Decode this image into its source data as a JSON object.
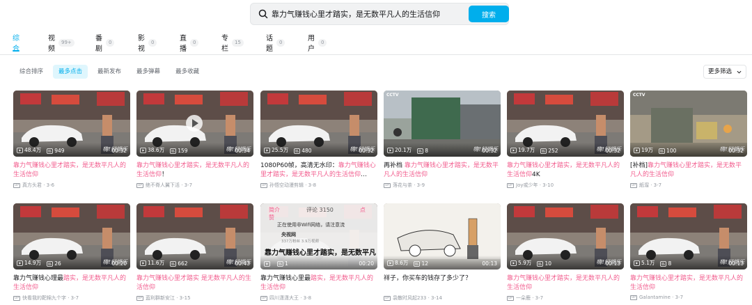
{
  "search": {
    "query": "靠力气赚钱心里才踏实，是无数平凡人的生活信仰",
    "button_label": "搜索"
  },
  "tabs": [
    {
      "label": "综合",
      "count": ""
    },
    {
      "label": "视频",
      "count": "99+"
    },
    {
      "label": "番剧",
      "count": "0"
    },
    {
      "label": "影视",
      "count": "0"
    },
    {
      "label": "直播",
      "count": "0"
    },
    {
      "label": "专栏",
      "count": "15"
    },
    {
      "label": "话题",
      "count": "0"
    },
    {
      "label": "用户",
      "count": "0"
    }
  ],
  "sort_options": [
    "综合排序",
    "最多点击",
    "最新发布",
    "最多弹幕",
    "最多收藏"
  ],
  "filter_label": "更多筛选",
  "videos": [
    {
      "views": "48.4万",
      "danmaku": "949",
      "duration": "00:32",
      "title_pre": "",
      "title_hl": "靠力气赚钱心里才踏实，是无数平凡人的生活信仰",
      "title_post": "",
      "author": "真方头君",
      "date": "3-6"
    },
    {
      "views": "38.6万",
      "danmaku": "159",
      "duration": "00:34",
      "title_pre": "",
      "title_hl": "靠力气赚钱心里才踏实，是无数平凡人的生活信仰",
      "title_post": "！",
      "author": "绝不脊人翼下活",
      "date": "3-7"
    },
    {
      "views": "25.5万",
      "danmaku": "480",
      "duration": "00:32",
      "title_pre": "1080P60帧，高清无水印：",
      "title_hl": "靠力气赚钱心里才踏实，是无数平凡人的生活信仰",
      "title_post": "…",
      "author": "孙悟空动漫剪辑",
      "date": "3-8"
    },
    {
      "views": "20.1万",
      "danmaku": "8",
      "duration": "00:32",
      "title_pre": "再补档 ",
      "title_hl": "靠力气赚钱心里才踏实，是无数平凡人的生活信仰",
      "title_post": "",
      "author": "落花与茶",
      "date": "3-9"
    },
    {
      "views": "19.7万",
      "danmaku": "252",
      "duration": "00:32",
      "title_pre": "",
      "title_hl": "靠力气赚钱心里才踏实，是无数平凡人的生活信仰",
      "title_post": "4K",
      "author": "Joy或少年",
      "date": "3-10"
    },
    {
      "views": "19万",
      "danmaku": "100",
      "duration": "00:32",
      "title_pre": "[补档]",
      "title_hl": "靠力气赚钱心里才踏实，是无数平凡人的生活信仰",
      "title_post": "",
      "author": "紙溜",
      "date": "3-7"
    },
    {
      "views": "14.9万",
      "danmaku": "26",
      "duration": "00:20",
      "title_pre": "靠力气赚钱心理最",
      "title_hl": "踏实，是无数平凡人的生活信仰",
      "title_post": "",
      "author": "快看我的靶棉九个字",
      "date": "3-7"
    },
    {
      "views": "11.6万",
      "danmaku": "662",
      "duration": "00:43",
      "title_pre": "",
      "title_hl": "靠力气赚钱心里才踏实 是无数平凡人的生活信仰",
      "title_post": "",
      "author": "蓝利群新安江",
      "date": "3-15"
    },
    {
      "views": "",
      "danmaku": "1",
      "duration": "00:20",
      "title_pre": "靠力气赚钱心里最",
      "title_hl": "踏实，是无数平凡人的生活信仰",
      "title_post": "",
      "author": "四川潇潇大王",
      "date": "3-8"
    },
    {
      "views": "8.6万",
      "danmaku": "12",
      "duration": "00:13",
      "title_pre": "祥子，你买车的钱存了多少了？",
      "title_hl": "",
      "title_post": "",
      "author": "袅散时风起233",
      "date": "3-14"
    },
    {
      "views": "5.9万",
      "danmaku": "10",
      "duration": "00:13",
      "title_pre": "",
      "title_hl": "靠力气赚钱心里才踏实，是无数平凡人的生活信仰",
      "title_post": "",
      "author": "一朵鹿",
      "date": "3-7"
    },
    {
      "views": "5.1万",
      "danmaku": "8",
      "duration": "00:13",
      "title_pre": "",
      "title_hl": "靠力气赚钱心里才踏实，是无数平凡人的生活信仰",
      "title_post": "",
      "author": "Galantamine",
      "date": "3-7"
    }
  ],
  "overlay": {
    "tab1": "简介",
    "tab2": "评论 3150",
    "tab3": "点赞",
    "notice": "正在使用非Wifi网络，请注意流",
    "channel": "央视网",
    "channel_stats": "337万粉丝  3.9万视频",
    "headline": "靠力气赚钱心里才踏实，是无数平凡",
    "logo_text": "CCTV"
  },
  "watermark_text": "嗨!好娱乐",
  "cctv_text": "CCTV",
  "colors": {
    "accent": "#00aeec",
    "highlight": "#f25d8e"
  }
}
